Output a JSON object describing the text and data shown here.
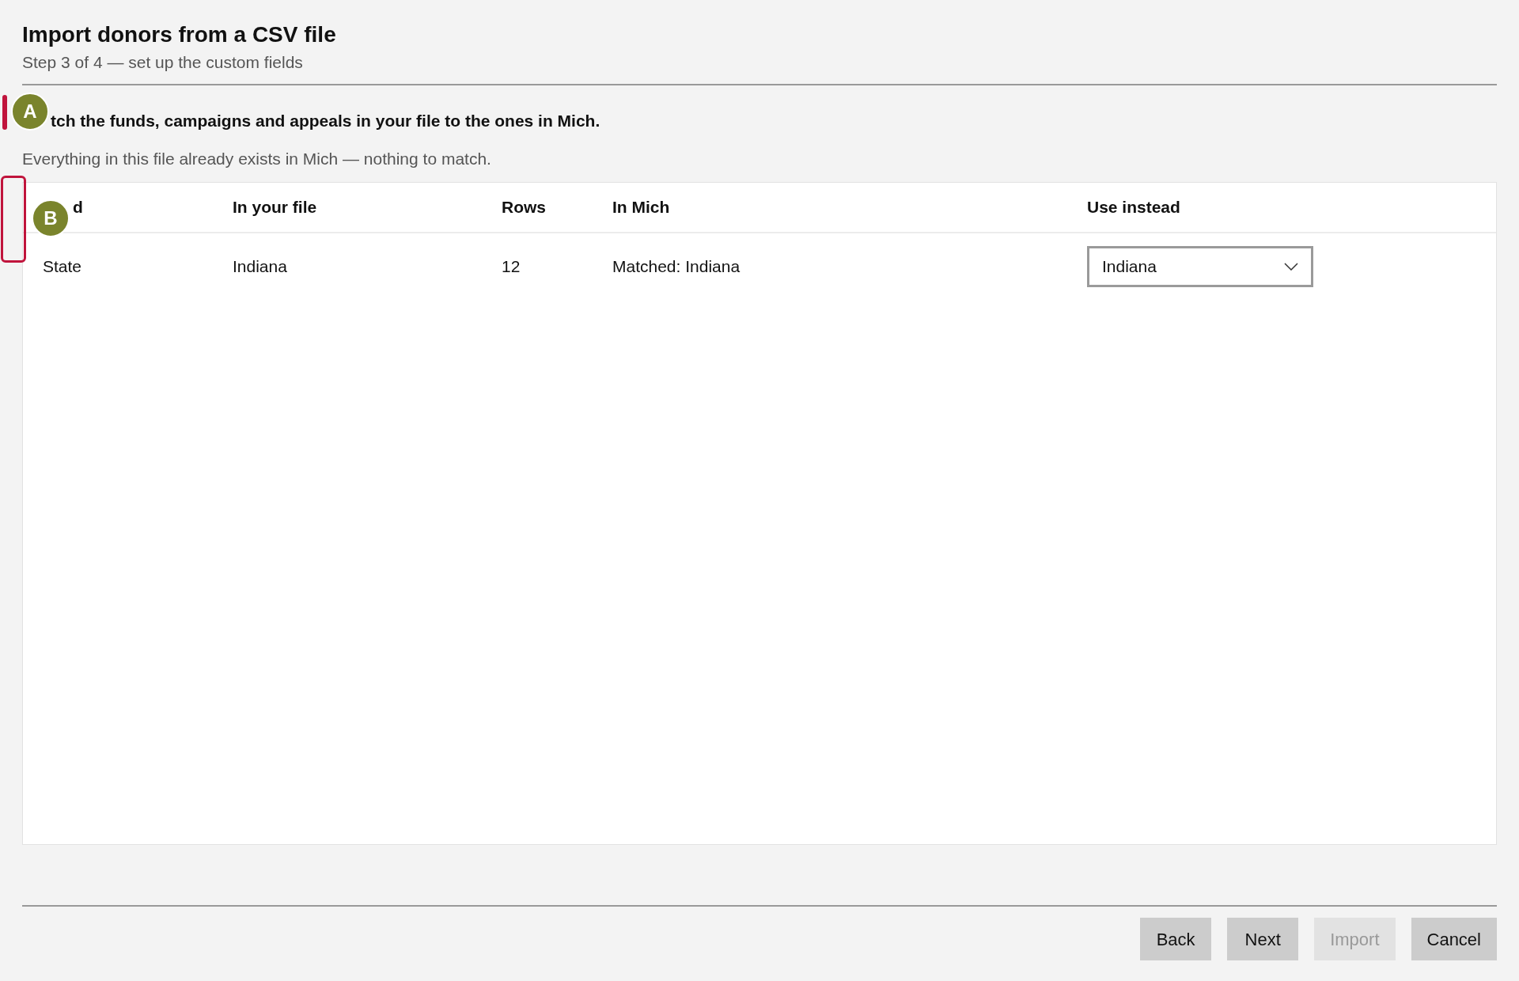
{
  "header": {
    "title": "Import donors from a CSV file",
    "subtitle": "Step 3 of 4 — set up the custom fields"
  },
  "section": {
    "heading": "tch the funds, campaigns and appeals in your file to the ones in Mich.",
    "description": "Everything in this file already exists in Mich — nothing to match."
  },
  "table": {
    "columns": [
      "d",
      "In your file",
      "Rows",
      "In Mich",
      "Use instead"
    ],
    "rows": [
      {
        "field": "State",
        "in_your_file": "Indiana",
        "rows": "12",
        "in_mich": "Matched: Indiana",
        "use_instead": "Indiana"
      }
    ]
  },
  "buttons": [
    {
      "label": "Back",
      "disabled": false
    },
    {
      "label": "Next",
      "disabled": false
    },
    {
      "label": "Import",
      "disabled": true
    },
    {
      "label": "Cancel",
      "disabled": false
    }
  ],
  "annotations": [
    {
      "label": "A",
      "kind": "bar"
    },
    {
      "label": "B",
      "kind": "box"
    }
  ]
}
